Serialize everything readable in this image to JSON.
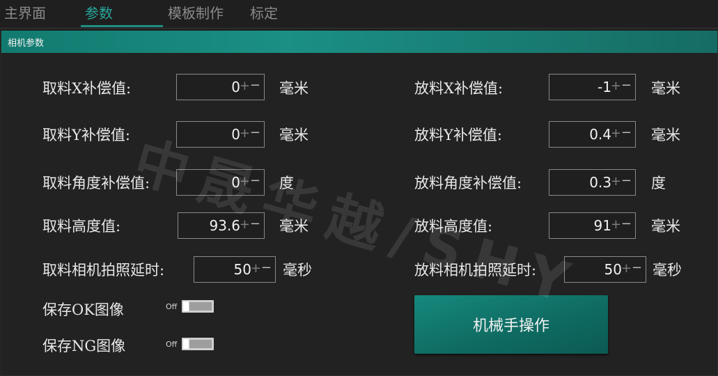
{
  "tabs": [
    {
      "label": "主界面"
    },
    {
      "label": "参数"
    },
    {
      "label": "模板制作"
    },
    {
      "label": "标定"
    }
  ],
  "panel": {
    "title": "相机参数"
  },
  "left": [
    {
      "label": "取料X补偿值:",
      "value": "0",
      "unit": "毫米"
    },
    {
      "label": "取料Y补偿值:",
      "value": "0",
      "unit": "毫米"
    },
    {
      "label": "取料角度补偿值:",
      "value": "0",
      "unit": "度"
    },
    {
      "label": "取料高度值:",
      "value": "93.6",
      "unit": "毫米"
    },
    {
      "label": "取料相机拍照延时:",
      "value": "50",
      "unit": "毫秒"
    }
  ],
  "right": [
    {
      "label": "放料X补偿值:",
      "value": "-1",
      "unit": "毫米"
    },
    {
      "label": "放料Y补偿值:",
      "value": "0.4",
      "unit": "毫米"
    },
    {
      "label": "放料角度补偿值:",
      "value": "0.3",
      "unit": "度"
    },
    {
      "label": "放料高度值:",
      "value": "91",
      "unit": "毫米"
    },
    {
      "label": "放料相机拍照延时:",
      "value": "50",
      "unit": "毫秒"
    }
  ],
  "stepper": {
    "plus": "+",
    "minus": "−"
  },
  "toggles": [
    {
      "label": "保存OK图像",
      "state": "Off"
    },
    {
      "label": "保存NG图像",
      "state": "Off"
    }
  ],
  "robot_button": {
    "label": "机械手操作"
  },
  "watermark": {
    "text": "中晟华越/SHY"
  },
  "colors": {
    "accent": "#1e8f83",
    "background": "#1f1f1f",
    "header": "#127a6f"
  }
}
